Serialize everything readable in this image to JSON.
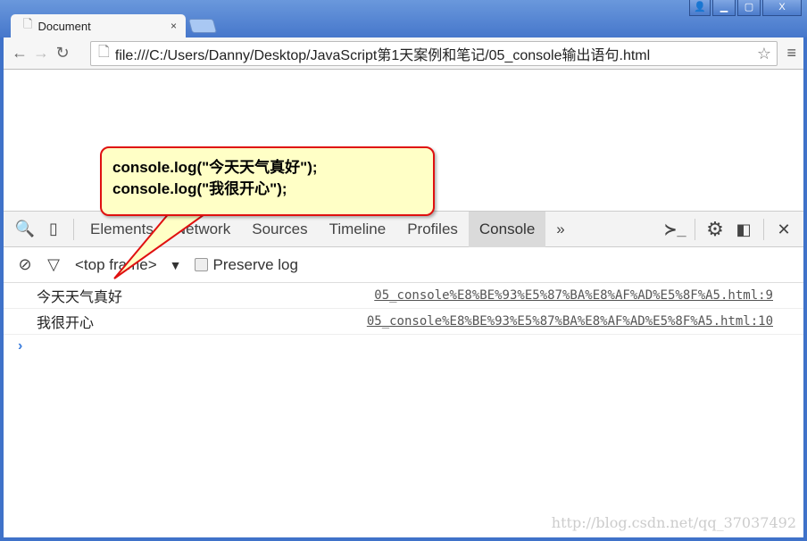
{
  "window": {
    "buttons": [
      "user",
      "minimize",
      "maximize",
      "close"
    ]
  },
  "tab": {
    "title": "Document",
    "close": "×"
  },
  "address": {
    "url": "file:///C:/Users/Danny/Desktop/JavaScript第1天案例和笔记/05_console输出语句.html"
  },
  "devtools": {
    "tabs": [
      "Elements",
      "Network",
      "Sources",
      "Timeline",
      "Profiles",
      "Console"
    ],
    "active_tab": "Console",
    "more": "»",
    "context": "<top frame>",
    "preserve_log": "Preserve log",
    "preserve_checked": false,
    "logs": [
      {
        "message": "今天天气真好",
        "source": "05_console%E8%BE%93%E5%87%BA%E8%AF%AD%E5%8F%A5.html:9"
      },
      {
        "message": "我很开心",
        "source": "05_console%E8%BE%93%E5%87%BA%E8%AF%AD%E5%8F%A5.html:10"
      }
    ],
    "prompt": "›"
  },
  "callout": {
    "line1": "console.log(\"今天天气真好\");",
    "line2": "console.log(\"我很开心\");"
  },
  "watermark": "http://blog.csdn.net/qq_37037492"
}
